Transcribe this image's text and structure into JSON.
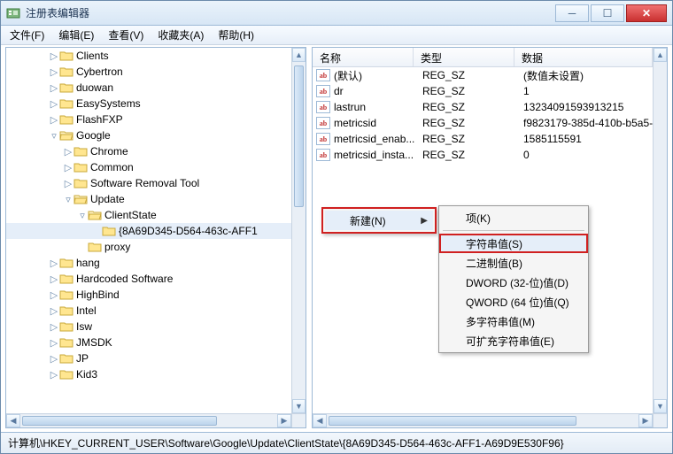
{
  "window": {
    "title": "注册表编辑器"
  },
  "menu": {
    "file": "文件(F)",
    "edit": "编辑(E)",
    "view": "查看(V)",
    "favorites": "收藏夹(A)",
    "help": "帮助(H)"
  },
  "tree": [
    {
      "l": 3,
      "e": "▷",
      "n": "Clients"
    },
    {
      "l": 3,
      "e": "▷",
      "n": "Cybertron"
    },
    {
      "l": 3,
      "e": "▷",
      "n": "duowan"
    },
    {
      "l": 3,
      "e": "▷",
      "n": "EasySystems"
    },
    {
      "l": 3,
      "e": "▷",
      "n": "FlashFXP"
    },
    {
      "l": 3,
      "e": "▿",
      "n": "Google",
      "open": true
    },
    {
      "l": 4,
      "e": "▷",
      "n": "Chrome"
    },
    {
      "l": 4,
      "e": "▷",
      "n": "Common"
    },
    {
      "l": 4,
      "e": "▷",
      "n": "Software Removal Tool"
    },
    {
      "l": 4,
      "e": "▿",
      "n": "Update",
      "open": true
    },
    {
      "l": 5,
      "e": "▿",
      "n": "ClientState",
      "open": true
    },
    {
      "l": 6,
      "e": "",
      "n": "{8A69D345-D564-463c-AFF1",
      "sel": true
    },
    {
      "l": 5,
      "e": "",
      "n": "proxy"
    },
    {
      "l": 3,
      "e": "▷",
      "n": "hang"
    },
    {
      "l": 3,
      "e": "▷",
      "n": "Hardcoded Software"
    },
    {
      "l": 3,
      "e": "▷",
      "n": "HighBind"
    },
    {
      "l": 3,
      "e": "▷",
      "n": "Intel"
    },
    {
      "l": 3,
      "e": "▷",
      "n": "Isw"
    },
    {
      "l": 3,
      "e": "▷",
      "n": "JMSDK"
    },
    {
      "l": 3,
      "e": "▷",
      "n": "JP"
    },
    {
      "l": 3,
      "e": "▷",
      "n": "Kid3"
    }
  ],
  "list": {
    "headers": {
      "name": "名称",
      "type": "类型",
      "data": "数据"
    },
    "rows": [
      {
        "name": "(默认)",
        "type": "REG_SZ",
        "data": "(数值未设置)"
      },
      {
        "name": "dr",
        "type": "REG_SZ",
        "data": "1"
      },
      {
        "name": "lastrun",
        "type": "REG_SZ",
        "data": "13234091593913215"
      },
      {
        "name": "metricsid",
        "type": "REG_SZ",
        "data": "f9823179-385d-410b-b5a5-"
      },
      {
        "name": "metricsid_enab...",
        "type": "REG_SZ",
        "data": "1585115591"
      },
      {
        "name": "metricsid_insta...",
        "type": "REG_SZ",
        "data": "0"
      }
    ]
  },
  "context": {
    "new": "新建(N)"
  },
  "submenu": {
    "key": "项(K)",
    "string": "字符串值(S)",
    "binary": "二进制值(B)",
    "dword": "DWORD (32-位)值(D)",
    "qword": "QWORD (64 位)值(Q)",
    "multi": "多字符串值(M)",
    "expand": "可扩充字符串值(E)"
  },
  "status": "计算机\\HKEY_CURRENT_USER\\Software\\Google\\Update\\ClientState\\{8A69D345-D564-463c-AFF1-A69D9E530F96}"
}
